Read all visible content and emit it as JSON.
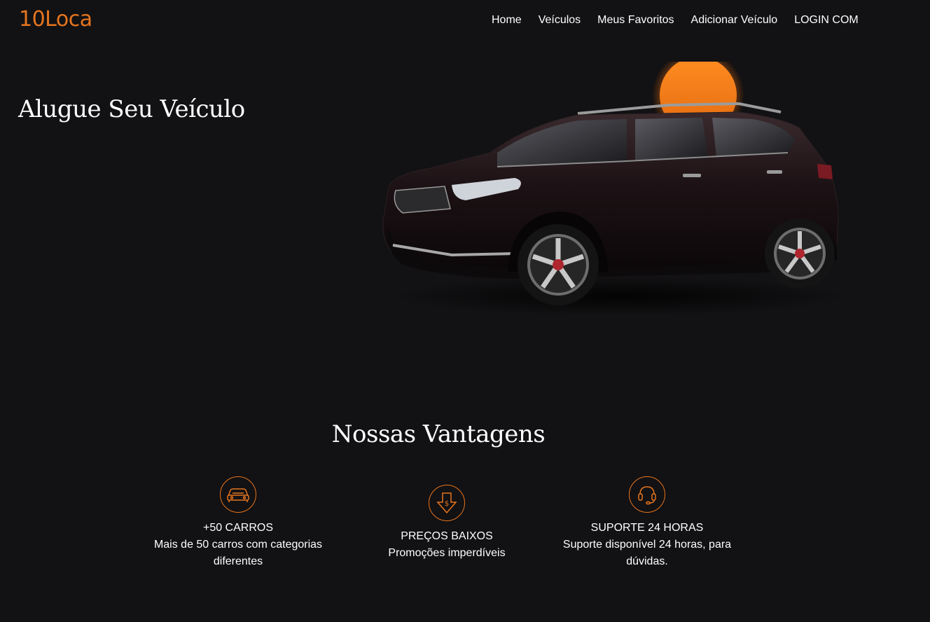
{
  "header": {
    "brand": "10Loca",
    "nav": [
      "Home",
      "Veículos",
      "Meus Favoritos",
      "Adicionar Veículo",
      "LOGIN COM"
    ]
  },
  "hero": {
    "title": "Alugue Seu Veículo",
    "image_description_icon": "suv-car-image"
  },
  "advantages": {
    "title": "Nossas Vantagens",
    "items": [
      {
        "icon": "car-icon",
        "title": "+50 CARROS",
        "description": "Mais de 50 carros com categorias diferentes"
      },
      {
        "icon": "price-down-icon",
        "title": "PREÇOS BAIXOS",
        "description": "Promoções imperdíveis"
      },
      {
        "icon": "headset-icon",
        "title": "SUPORTE 24 HORAS",
        "description": "Suporte disponível 24 horas, para dúvidas."
      }
    ]
  },
  "colors": {
    "background": "#121113",
    "accent": "#e5751f",
    "text": "#ffffff"
  }
}
